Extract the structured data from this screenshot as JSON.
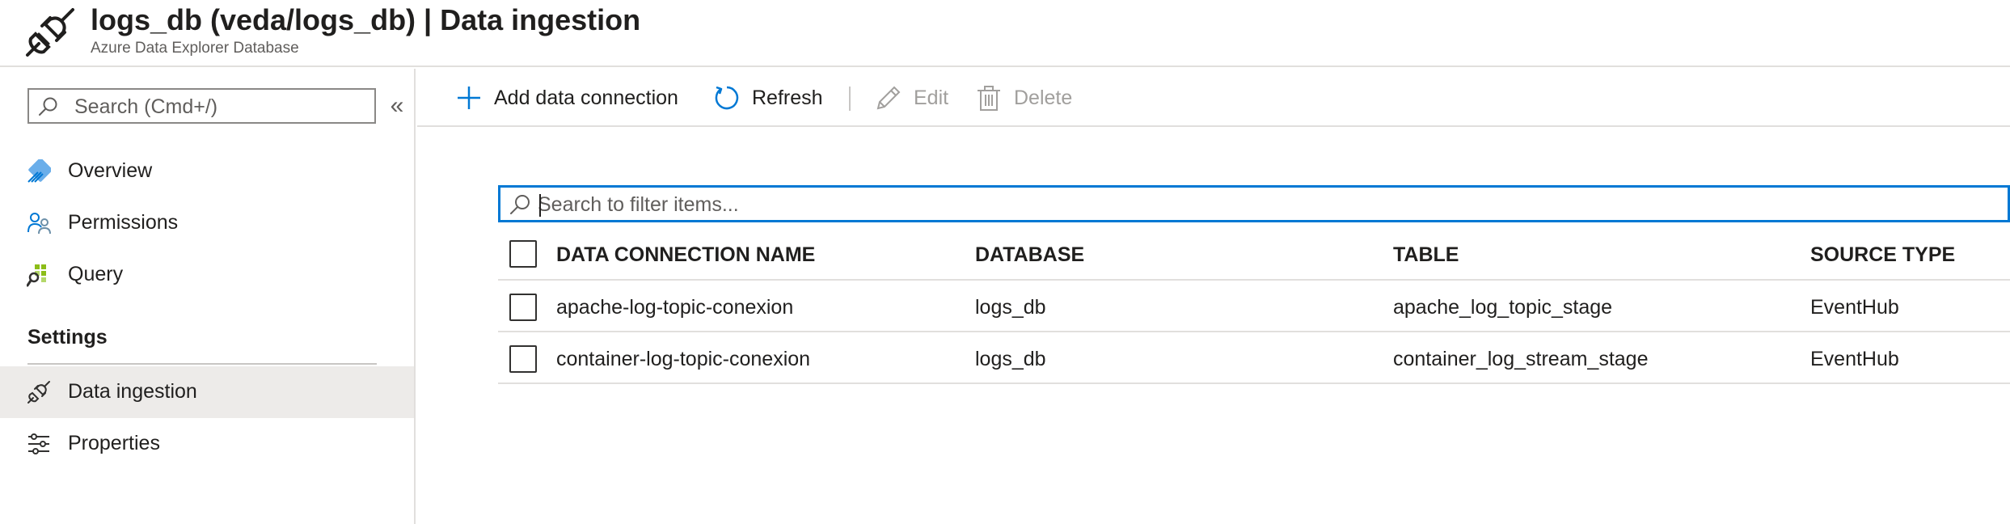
{
  "header": {
    "title": "logs_db (veda/logs_db) | Data ingestion",
    "subtitle": "Azure Data Explorer Database"
  },
  "sidebar": {
    "search_placeholder": "Search (Cmd+/)",
    "collapse_glyph": "«",
    "items": [
      {
        "label": "Overview",
        "icon": "overview-icon"
      },
      {
        "label": "Permissions",
        "icon": "permissions-icon"
      },
      {
        "label": "Query",
        "icon": "query-icon"
      }
    ],
    "section_label": "Settings",
    "settings_items": [
      {
        "label": "Data ingestion",
        "icon": "plug-icon",
        "selected": true
      },
      {
        "label": "Properties",
        "icon": "sliders-icon"
      }
    ]
  },
  "toolbar": {
    "add_label": "Add data connection",
    "refresh_label": "Refresh",
    "edit_label": "Edit",
    "delete_label": "Delete"
  },
  "filter": {
    "placeholder": "Search to filter items..."
  },
  "table": {
    "columns": [
      "DATA CONNECTION NAME",
      "DATABASE",
      "TABLE",
      "SOURCE TYPE"
    ],
    "rows": [
      [
        "apache-log-topic-conexion",
        "logs_db",
        "apache_log_topic_stage",
        "EventHub"
      ],
      [
        "container-log-topic-conexion",
        "logs_db",
        "container_log_stream_stage",
        "EventHub"
      ]
    ]
  },
  "colors": {
    "accent": "#0078d4",
    "text": "#201f1e",
    "muted": "#605e5c",
    "disabled": "#a19f9d",
    "selected_bg": "#edebe9",
    "border": "#e1dfdd"
  }
}
